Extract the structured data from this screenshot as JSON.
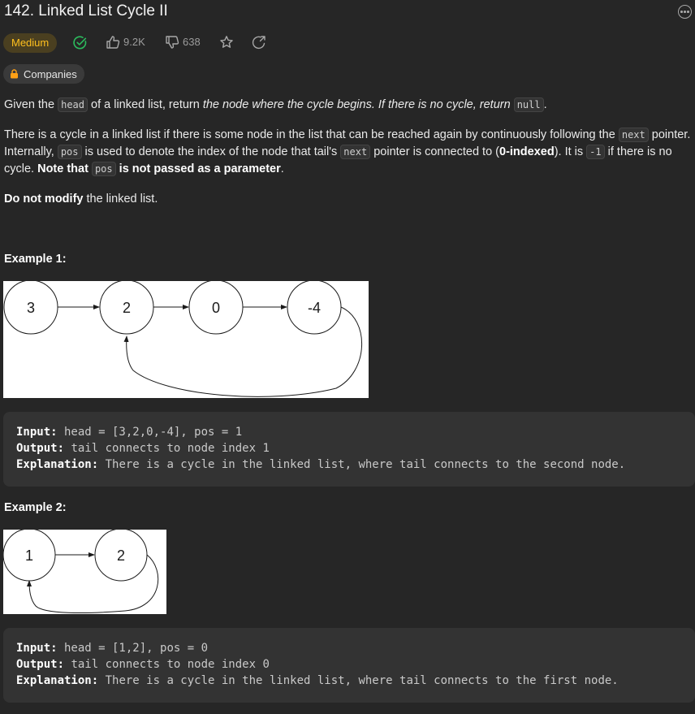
{
  "problem": {
    "title": "142. Linked List Cycle II",
    "difficulty": "Medium",
    "likes": "9.2K",
    "dislikes": "638",
    "companies_label": "Companies"
  },
  "description": {
    "p1": {
      "a": "Given the ",
      "code_head": "head",
      "b": " of a linked list, return ",
      "em": "the node where the cycle begins. If there is no cycle, return ",
      "code_null": "null",
      "c": "."
    },
    "p2": {
      "line1_a": "There is a cycle in a linked list if there is some node in the list that can be reached again by continuously following the ",
      "line1_code": "next",
      "line1_b": " pointer.",
      "line2_a": "Internally, ",
      "line2_code1": "pos",
      "line2_b": " is used to denote the index of the node that tail's ",
      "line2_code2": "next",
      "line2_c": " pointer is connected to (",
      "line2_bold": "0-indexed",
      "line2_d": "). It is ",
      "line2_code3": "-1",
      "line2_e": " if there is no",
      "line3_a": "cycle. ",
      "line3_bold1": "Note that ",
      "line3_code": "pos",
      "line3_bold2": " is not passed as a parameter",
      "line3_b": "."
    },
    "p3": {
      "bold": "Do not modify",
      "rest": " the linked list."
    }
  },
  "examples": [
    {
      "title": "Example 1:",
      "nodes": [
        "3",
        "2",
        "0",
        "-4"
      ],
      "input_label": "Input:",
      "input_value": " head = [3,2,0,-4], pos = 1",
      "output_label": "Output:",
      "output_value": " tail connects to node index 1",
      "explanation_label": "Explanation:",
      "explanation_value": " There is a cycle in the linked list, where tail connects to the second node."
    },
    {
      "title": "Example 2:",
      "nodes": [
        "1",
        "2"
      ],
      "input_label": "Input:",
      "input_value": " head = [1,2], pos = 0",
      "output_label": "Output:",
      "output_value": " tail connects to node index 0",
      "explanation_label": "Explanation:",
      "explanation_value": " There is a cycle in the linked list, where tail connects to the first node."
    }
  ],
  "icons": {
    "solved": "check-circle-icon",
    "like": "thumbs-up-icon",
    "dislike": "thumbs-down-icon",
    "favorite": "star-icon",
    "share": "share-icon",
    "lock": "lock-icon",
    "more": "more-icon"
  },
  "colors": {
    "background": "#262626",
    "medium": "#ffc01e",
    "solved": "#2cbb5d",
    "code_block": "#333333"
  }
}
